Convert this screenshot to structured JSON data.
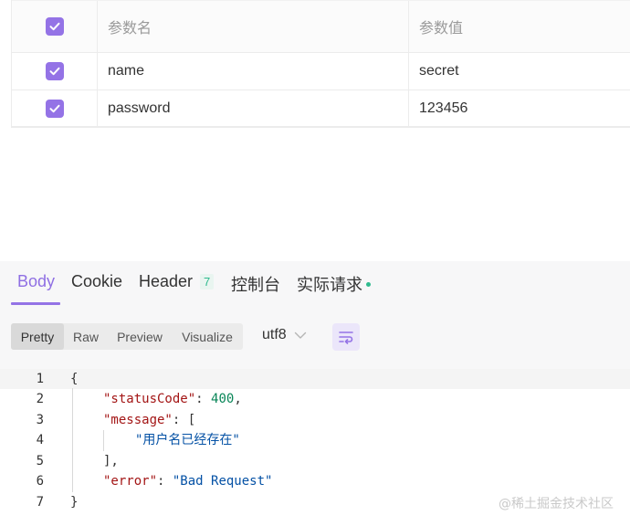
{
  "params": {
    "header": {
      "name": "参数名",
      "value": "参数值"
    },
    "rows": [
      {
        "name": "name",
        "value": "secret",
        "checked": true
      },
      {
        "name": "password",
        "value": "123456",
        "checked": true
      }
    ]
  },
  "response": {
    "tabs": [
      {
        "label": "Body"
      },
      {
        "label": "Cookie"
      },
      {
        "label": "Header",
        "badge": "7"
      },
      {
        "label": "控制台"
      },
      {
        "label": "实际请求"
      }
    ],
    "active_tab": "Body",
    "view_modes": [
      "Pretty",
      "Raw",
      "Preview",
      "Visualize"
    ],
    "active_view_mode": "Pretty",
    "encoding": "utf8",
    "code_lines": [
      {
        "num": "1",
        "text": "{"
      },
      {
        "num": "2",
        "key": "\"statusCode\"",
        "sep": ": ",
        "num_val": "400",
        "tail": ","
      },
      {
        "num": "3",
        "key": "\"message\"",
        "sep": ": ",
        "tail": "["
      },
      {
        "num": "4",
        "str": "\"用户名已经存在\""
      },
      {
        "num": "5",
        "text": "],"
      },
      {
        "num": "6",
        "key": "\"error\"",
        "sep": ": ",
        "str": "\"Bad Request\""
      },
      {
        "num": "7",
        "text": "}"
      }
    ]
  },
  "watermark": "@稀土掘金技术社区",
  "colors": {
    "accent": "#9473e6",
    "badge_green": "#2fba8e",
    "json_key": "#a31515",
    "json_string": "#0451a5",
    "json_number": "#098658"
  }
}
